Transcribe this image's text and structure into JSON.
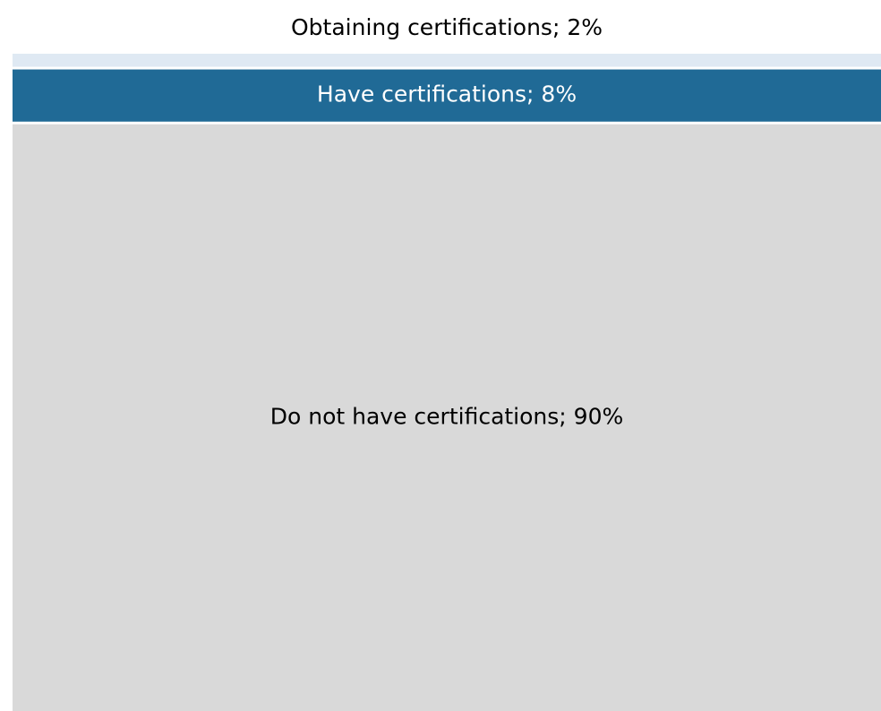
{
  "chart_data": {
    "type": "treemap",
    "title": "",
    "segments": [
      {
        "name": "Obtaining certifications",
        "value": 2,
        "label": "Obtaining certifications; 2%",
        "color": "#dfe9f3",
        "text_color": "#000000",
        "label_position": "outside-above"
      },
      {
        "name": "Have certifications",
        "value": 8,
        "label": "Have certifications; 8%",
        "color": "#206a96",
        "text_color": "#ffffff",
        "label_position": "inside"
      },
      {
        "name": "Do not have certifications",
        "value": 90,
        "label": "Do not have certifications; 90%",
        "color": "#d9d9d9",
        "text_color": "#000000",
        "label_position": "inside"
      }
    ]
  }
}
